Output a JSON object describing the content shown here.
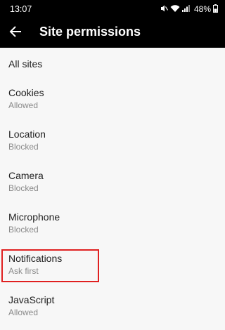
{
  "status_bar": {
    "time": "13:07",
    "battery": "48%",
    "icons": [
      "mute-icon",
      "wifi-icon",
      "signal-icon",
      "battery-icon"
    ]
  },
  "app_bar": {
    "title": "Site permissions",
    "back_icon": "arrow-left-icon"
  },
  "list": {
    "all_sites": "All sites",
    "items": [
      {
        "title": "Cookies",
        "status": "Allowed"
      },
      {
        "title": "Location",
        "status": "Blocked"
      },
      {
        "title": "Camera",
        "status": "Blocked"
      },
      {
        "title": "Microphone",
        "status": "Blocked"
      },
      {
        "title": "Notifications",
        "status": "Ask first"
      },
      {
        "title": "JavaScript",
        "status": "Allowed"
      }
    ]
  },
  "colors": {
    "header_bg": "#000000",
    "page_bg": "#f7f7f7",
    "highlight": "#e02020"
  }
}
